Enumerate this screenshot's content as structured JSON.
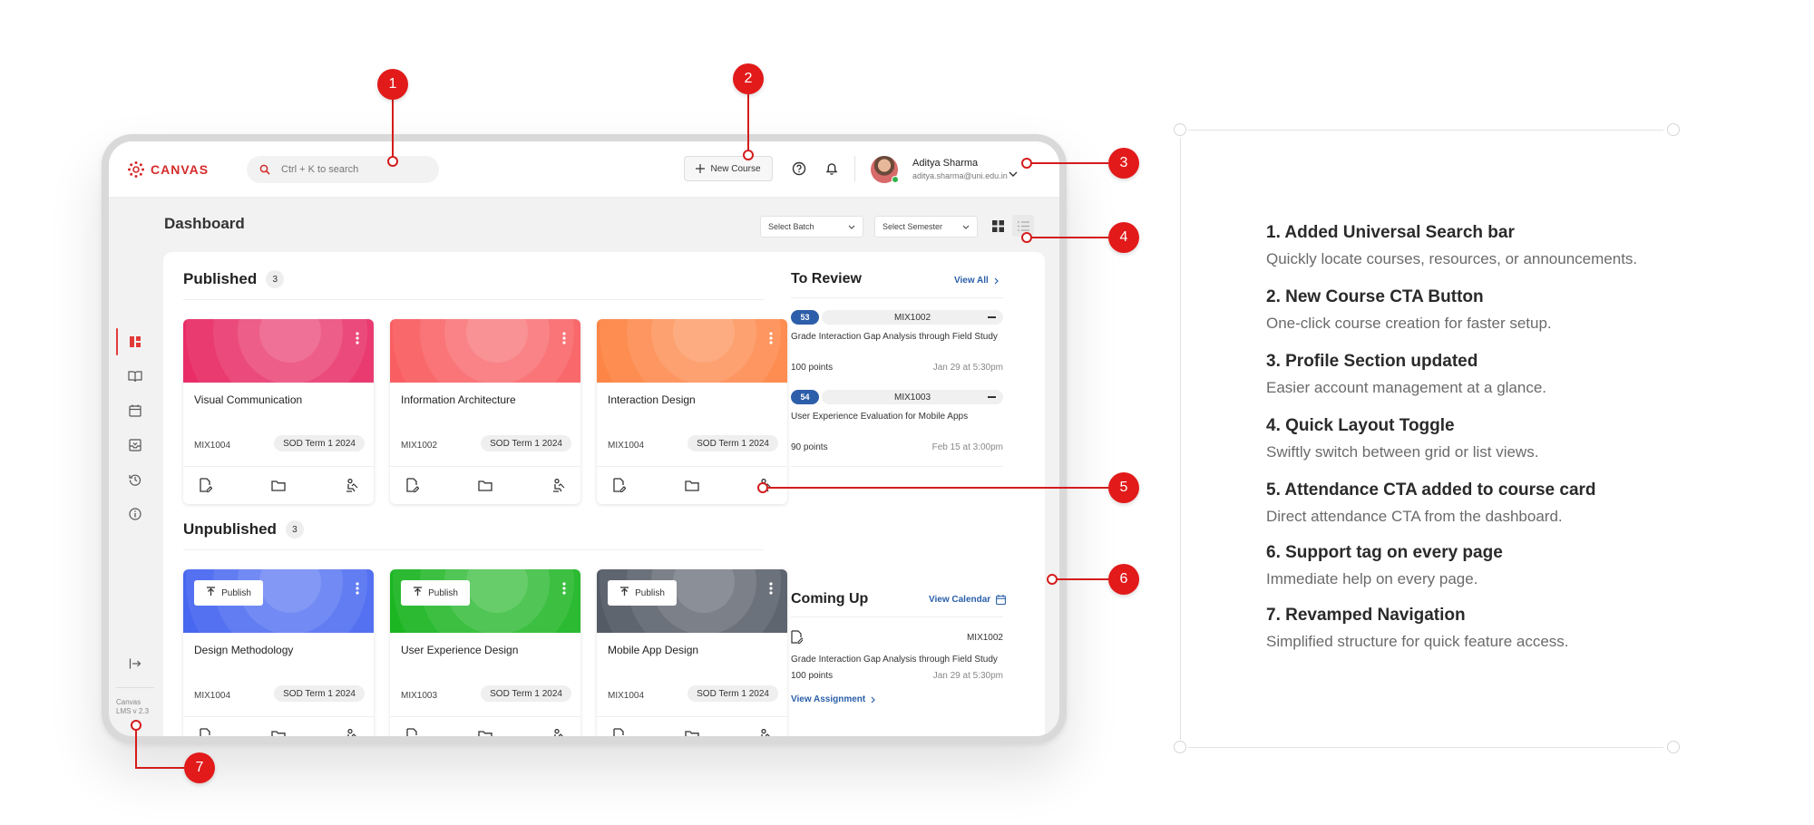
{
  "app": {
    "logo_text": "CANVAS",
    "search_placeholder": "Ctrl + K to search",
    "new_course_label": "New Course",
    "user": {
      "name": "Aditya Sharma",
      "email": "aditya.sharma@uni.edu.in"
    },
    "version": "Canvas LMS v 2.3"
  },
  "dashboard": {
    "title": "Dashboard",
    "select_batch": "Select Batch",
    "select_semester": "Select Semester"
  },
  "published": {
    "title": "Published",
    "count": "3",
    "courses": [
      {
        "title": "Visual Communication",
        "code": "MIX1004",
        "term": "SOD Term 1 2024",
        "color": "#e8225e"
      },
      {
        "title": "Information Architecture",
        "code": "MIX1002",
        "term": "SOD Term 1 2024",
        "color": "#f9575a"
      },
      {
        "title": "Interaction Design",
        "code": "MIX1004",
        "term": "SOD Term 1 2024",
        "color": "#fd7f3c"
      }
    ]
  },
  "unpublished": {
    "title": "Unpublished",
    "count": "3",
    "publish_label": "Publish",
    "courses": [
      {
        "title": "Design Methodology",
        "code": "MIX1004",
        "term": "SOD Term 1 2024",
        "color": "#3f5ff0"
      },
      {
        "title": "User Experience Design",
        "code": "MIX1003",
        "term": "SOD Term 1 2024",
        "color": "#10b318"
      },
      {
        "title": "Mobile App Design",
        "code": "MIX1004",
        "term": "SOD Term 1 2024",
        "color": "#4b535d"
      }
    ]
  },
  "to_review": {
    "title": "To Review",
    "view_all": "View All",
    "items": [
      {
        "badge": "53",
        "code": "MIX1002",
        "text": "Grade Interaction Gap Analysis through Field Study",
        "points": "100 points",
        "date": "Jan 29 at 5:30pm"
      },
      {
        "badge": "54",
        "code": "MIX1003",
        "text": "User Experience Evaluation for Mobile Apps",
        "points": "90 points",
        "date": "Feb 15 at 3:00pm"
      }
    ]
  },
  "coming_up": {
    "title": "Coming Up",
    "view_calendar": "View Calendar",
    "code": "MIX1002",
    "text": "Grade Interaction Gap Analysis through Field Study",
    "points": "100 points",
    "date": "Jan 29 at 5:30pm",
    "view_assignment": "View Assignment"
  },
  "markers": [
    "1",
    "2",
    "3",
    "4",
    "5",
    "6",
    "7"
  ],
  "features": [
    {
      "title": "1.  Added Universal Search bar",
      "desc": "Quickly locate courses, resources, or announcements."
    },
    {
      "title": "2.  New Course CTA Button",
      "desc": "One-click course creation for faster setup."
    },
    {
      "title": "3.  Profile Section updated",
      "desc": "Easier account management at a glance."
    },
    {
      "title": "4.  Quick Layout Toggle",
      "desc": "Swiftly switch between grid or list views."
    },
    {
      "title": "5.  Attendance CTA added to course card",
      "desc": "Direct attendance CTA from the dashboard."
    },
    {
      "title": "6.  Support tag on every page",
      "desc": "Immediate help on every page."
    },
    {
      "title": "7.  Revamped Navigation",
      "desc": "Simplified structure for quick feature access."
    }
  ],
  "colors": {
    "brand": "#d52b2b",
    "marker": "#e21a1a",
    "link": "#2a5fa8",
    "badge": "#2d5ea9"
  }
}
